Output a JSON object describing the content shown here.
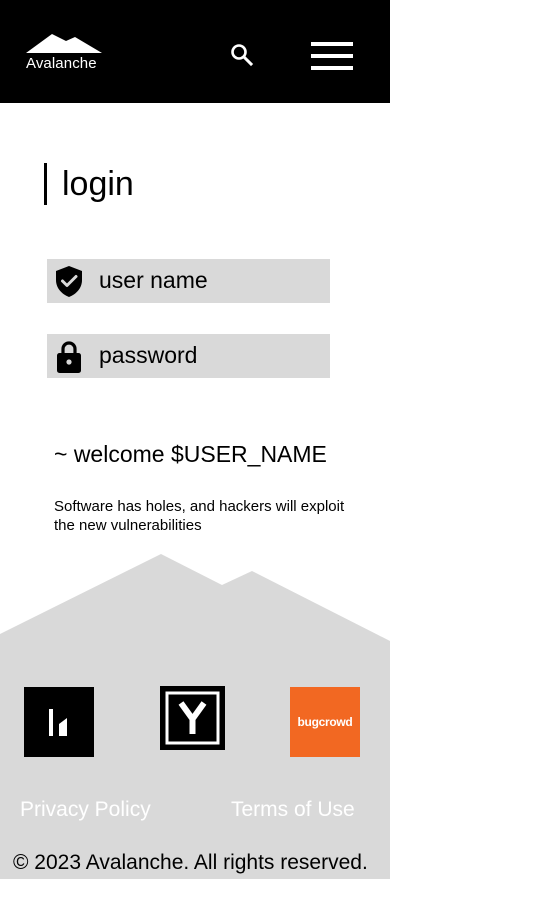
{
  "header": {
    "logo_text": "Avalanche",
    "search_icon": "search-icon",
    "menu_icon": "hamburger-menu-icon"
  },
  "login": {
    "title": "login",
    "username_placeholder": "user name",
    "username_icon": "shield-check-icon",
    "password_placeholder": "password",
    "password_icon": "lock-icon"
  },
  "welcome": {
    "text": "~ welcome $USER_NAME",
    "tagline": "Software has holes, and hackers will exploit the new vulnerabilities"
  },
  "sponsors": {
    "hackerone_logo": "hackerone-logo-icon",
    "ycombinator_logo": "ycombinator-logo-icon",
    "bugcrowd_label": "bugcrowd"
  },
  "footer": {
    "privacy_label": "Privacy Policy",
    "terms_label": "Terms of Use",
    "copyright": "© 2023 Avalanche. All rights reserved."
  },
  "colors": {
    "header_bg": "#000000",
    "field_bg": "#d9d9d9",
    "footer_bg": "#d9d9d9",
    "bugcrowd_orange": "#f26822",
    "footer_link": "#ffffff"
  }
}
